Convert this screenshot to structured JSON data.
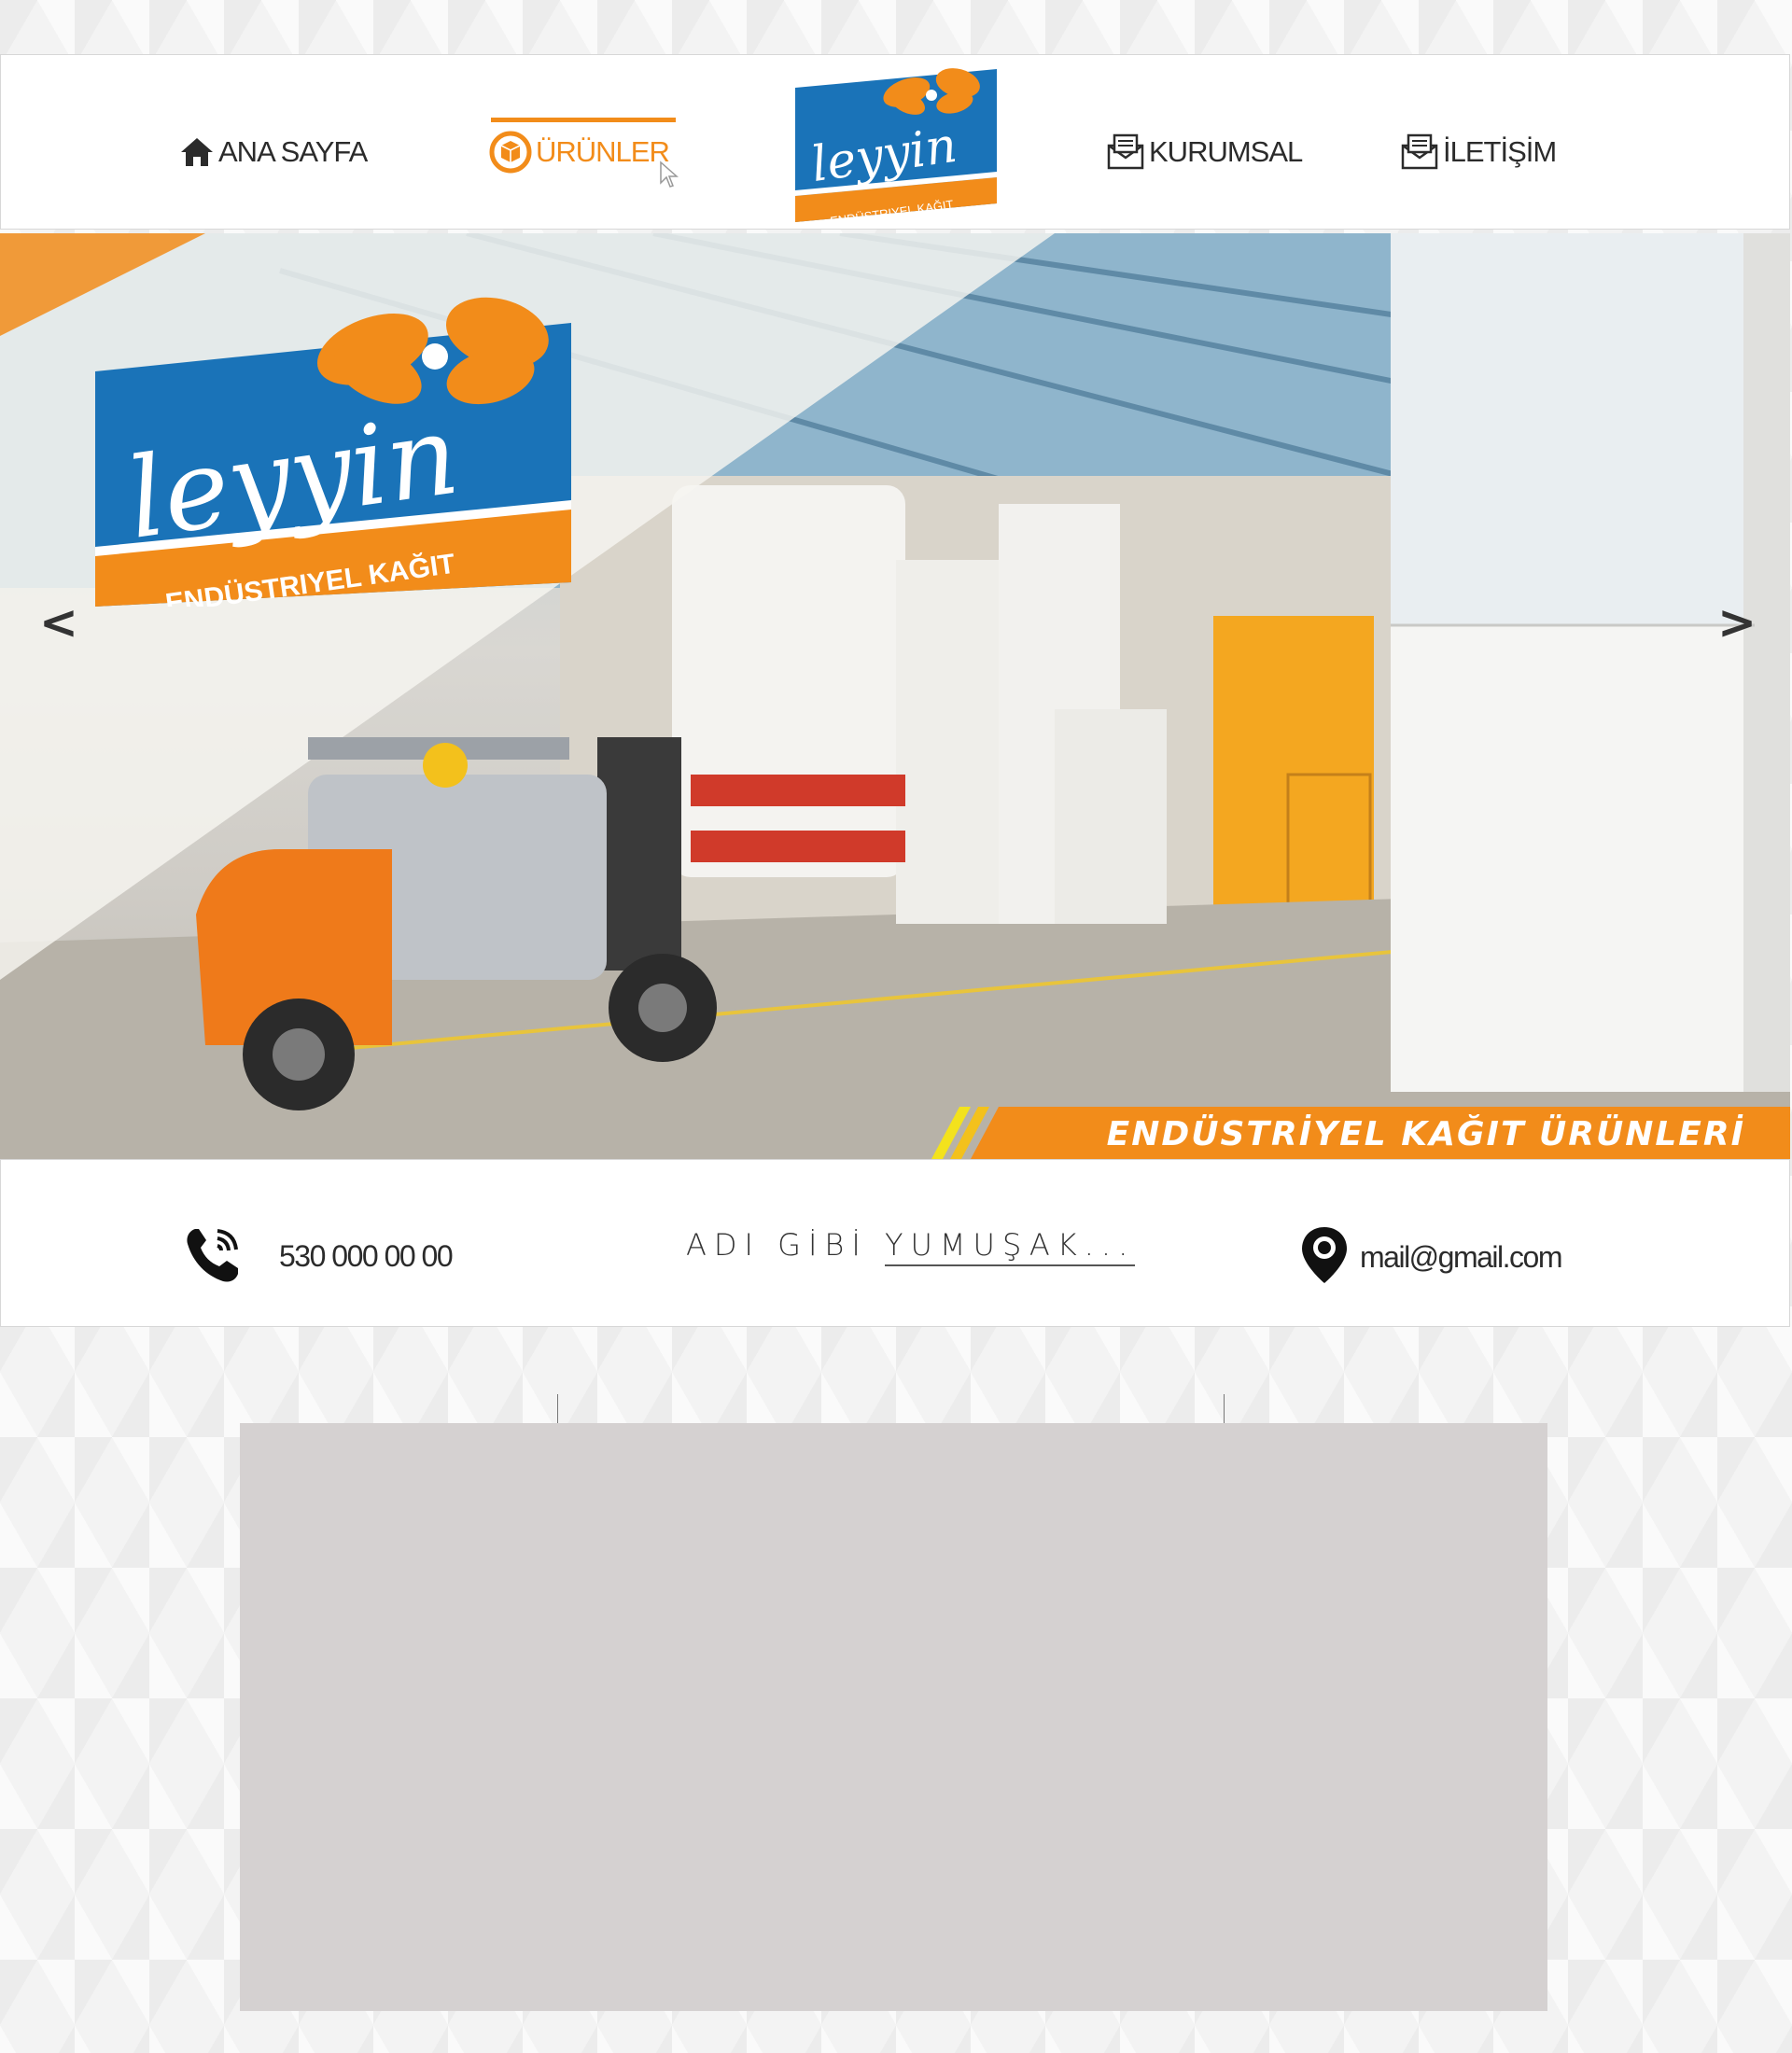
{
  "nav": {
    "home_label": "ANA SAYFA",
    "products_label": "ÜRÜNLER",
    "corporate_label": "KURUMSAL",
    "contact_label": "İLETİŞİM",
    "active": "products"
  },
  "brand": {
    "name": "leyyin",
    "subtitle": "ENDÜSTRIYEL KAĞIT",
    "subtitle_big": "ENDÜSTRIYEL KAĞIT"
  },
  "hero": {
    "prev_label": "<",
    "next_label": ">",
    "banner_text": "ENDÜSTRİYEL KAĞIT ÜRÜNLERİ"
  },
  "info": {
    "phone": "530 000 00 00",
    "tagline_part1": "ADI GİBİ ",
    "tagline_part2": "YUMUŞAK...",
    "email": "mail@gmail.com"
  },
  "colors": {
    "accent_orange": "#f28c1a",
    "brand_blue": "#1a73b8",
    "content_box": "#d5d1d1"
  },
  "icons": {
    "home": "home-icon",
    "products": "box-icon",
    "corporate": "document-icon",
    "contact": "document-icon",
    "phone": "phone-icon",
    "location": "location-pin-icon"
  }
}
